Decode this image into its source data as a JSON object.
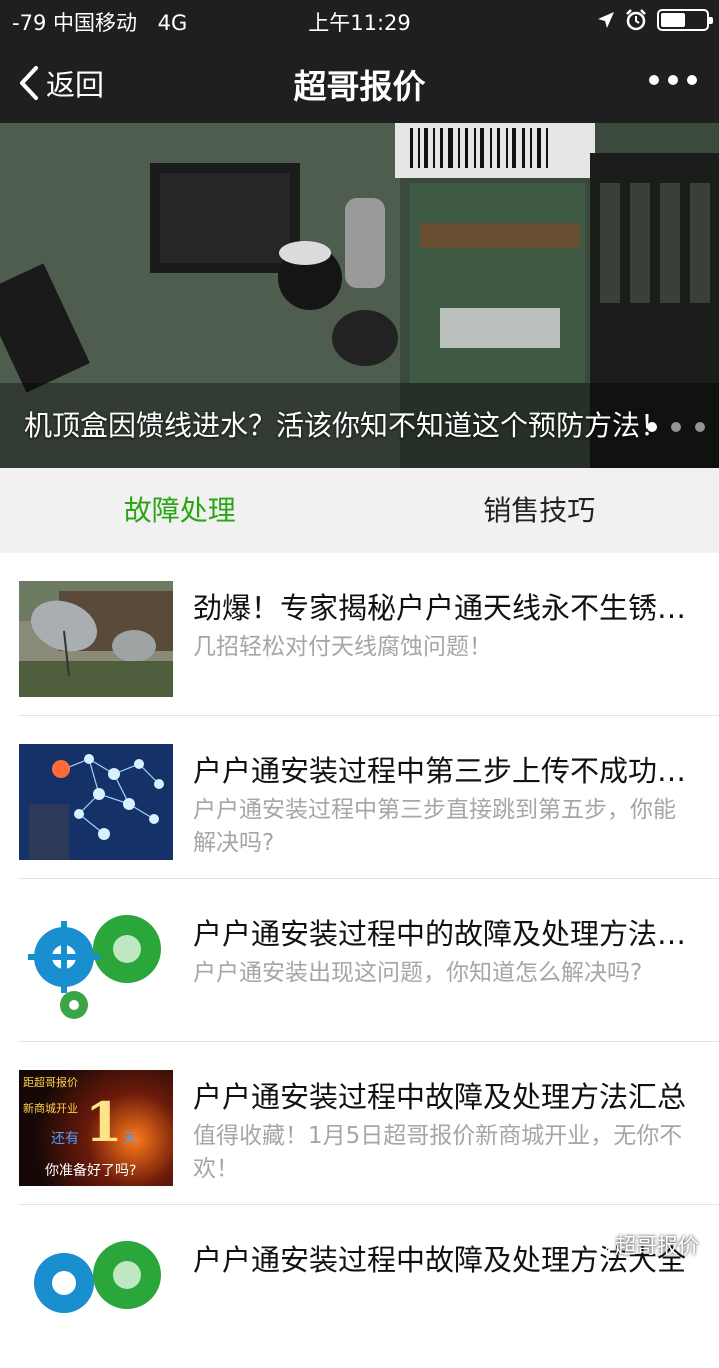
{
  "status_bar": {
    "carrier": "-79 中国移动",
    "network": "4G",
    "time": "上午11:29"
  },
  "nav": {
    "back_label": "返回",
    "title": "超哥报价"
  },
  "banner": {
    "caption": "机顶盒因馈线进水？活该你知不知道这个预防方法！"
  },
  "tabs": [
    {
      "label": "故障处理"
    },
    {
      "label": "销售技巧"
    }
  ],
  "articles": [
    {
      "title": "劲爆！专家揭秘户户通天线永不生锈的方法",
      "desc": "几招轻松对付天线腐蚀问题！"
    },
    {
      "title": "户户通安装过程中第三步上传不成功怎么办",
      "desc": "户户通安装过程中第三步直接跳到第五步，你能解决吗?"
    },
    {
      "title": "户户通安装过程中的故障及处理方法大全",
      "desc": "户户通安装出现这问题，你知道怎么解决吗?"
    },
    {
      "title": "户户通安装过程中故障及处理方法汇总",
      "desc": "值得收藏！1月5日超哥报价新商城开业，无你不欢！"
    },
    {
      "title": "户户通安装过程中故障及处理方法大全",
      "desc": ""
    }
  ],
  "thumb_text": {
    "poster_line1": "距超哥报价",
    "poster_line2": "新商城开业",
    "poster_prefix": "还有",
    "poster_number": "1",
    "poster_suffix": "天",
    "poster_line3": "你准备好了吗?"
  },
  "watermark": "超哥报价",
  "colors": {
    "accent_green": "#2aa515",
    "nav_bg": "#1f1f1f",
    "tab_bg": "#f1f1f1"
  },
  "icons": [
    "back-chevron-icon",
    "more-icon",
    "location-arrow-icon",
    "alarm-icon",
    "battery-icon",
    "wechat-icon"
  ]
}
